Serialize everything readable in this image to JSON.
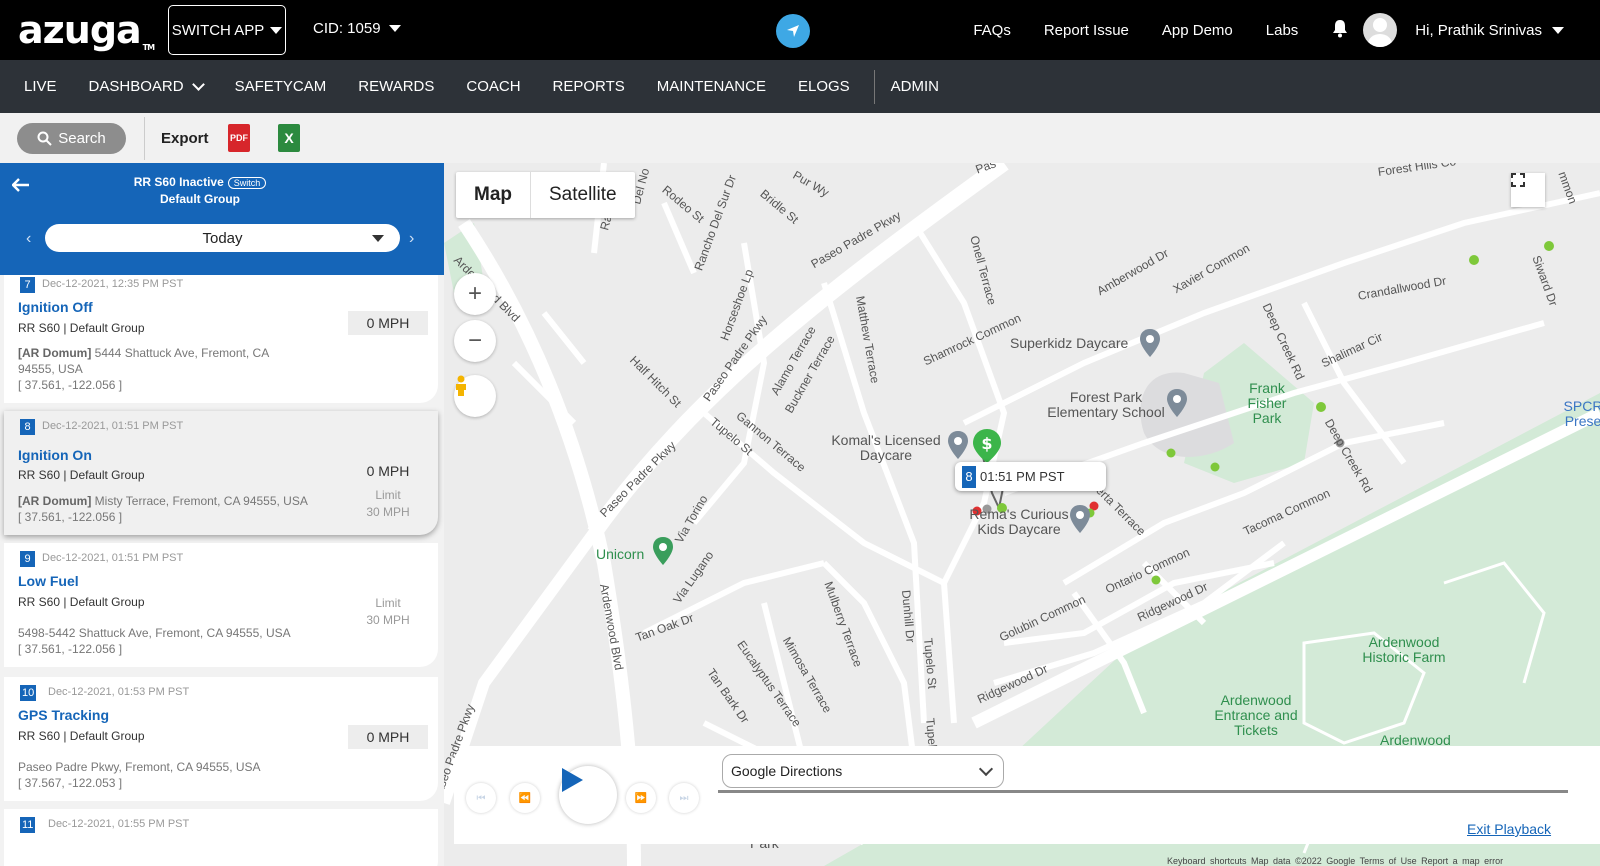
{
  "header": {
    "logo_text": "azuga",
    "logo_tm": "TM",
    "switch_app_label": "SWITCH APP",
    "cid_label": "CID: 1059",
    "links": [
      "FAQs",
      "Report Issue",
      "App Demo",
      "Labs"
    ],
    "greeting": "Hi, Prathik Srinivas",
    "nav_accent": "#3ea8e5"
  },
  "nav": {
    "items": [
      "LIVE",
      "DASHBOARD",
      "SAFETYCAM",
      "REWARDS",
      "COACH",
      "REPORTS",
      "MAINTENANCE",
      "ELOGS"
    ],
    "admin": "ADMIN"
  },
  "toolbar": {
    "search_label": "Search",
    "export_label": "Export",
    "pdf_label": "PDF",
    "xls_label": "X"
  },
  "vehicle": {
    "title": "RR S60 Inactive",
    "switch_label": "Switch",
    "group": "Default Group",
    "date_value": "Today"
  },
  "events": [
    {
      "num": "7",
      "time": "Dec-12-2021, 12:35 PM PST",
      "title": "Ignition Off",
      "sub": "RR S60 | Default Group",
      "addr_bold": "[AR Domum]",
      "addr": " 5444 Shattuck Ave, Fremont, CA 94555, USA",
      "coords": "[ 37.561, -122.056 ]",
      "speed": "0 MPH",
      "limit_label": "",
      "limit_value": ""
    },
    {
      "num": "8",
      "time": "Dec-12-2021, 01:51 PM PST",
      "title": "Ignition On",
      "sub": "RR S60 | Default Group",
      "addr_bold": "[AR Domum]",
      "addr": " Misty Terrace, Fremont, CA 94555, USA",
      "coords": "[ 37.561, -122.056 ]",
      "speed": "0 MPH",
      "limit_label": "Limit",
      "limit_value": "30 MPH"
    },
    {
      "num": "9",
      "time": "Dec-12-2021, 01:51 PM PST",
      "title": "Low Fuel",
      "sub": "RR S60 | Default Group",
      "addr_bold": "",
      "addr": "5498-5442 Shattuck Ave, Fremont, CA 94555, USA",
      "coords": "[ 37.561, -122.056 ]",
      "speed": "",
      "limit_label": "Limit",
      "limit_value": "30 MPH"
    },
    {
      "num": "10",
      "time": "Dec-12-2021, 01:53 PM PST",
      "title": "GPS Tracking",
      "sub": "RR S60 | Default Group",
      "addr_bold": "",
      "addr": "Paseo Padre Pkwy, Fremont, CA 94555, USA",
      "coords": "[ 37.567, -122.053 ]",
      "speed": "0 MPH",
      "limit_label": "",
      "limit_value": ""
    },
    {
      "num": "11",
      "time": "Dec-12-2021, 01:55 PM PST",
      "title": "",
      "sub": "",
      "addr_bold": "",
      "addr": "",
      "coords": "",
      "speed": "",
      "limit_label": "",
      "limit_value": ""
    }
  ],
  "map": {
    "type_map": "Map",
    "type_satellite": "Satellite",
    "zoom_in": "+",
    "zoom_out": "−",
    "tooltip_num": "8",
    "tooltip_time": "01:51 PM PST",
    "marker_letter": "$",
    "pois": {
      "superkidz": "Superkidz Daycare",
      "forest_park": "Forest Park Elementary School",
      "frank_fisher": "Frank Fisher Park",
      "komals": "Komal's Licensed Daycare",
      "remas": "Rema's Curious Kids Daycare",
      "unicorn": "Unicorn",
      "ardenwood_farm": "Ardenwood Historic Farm",
      "ardenwood_entrance": "Ardenwood Entrance and Tickets",
      "ardenwood_bottom": "Ardenwood",
      "spcr": "SPCR Prese",
      "park_bottom": "Park"
    },
    "streets": {
      "paseo1": "Paseo Padre Pkwy",
      "paseo2": "Paseo Padre Pkwy",
      "paseo3": "Paseo Padre Pkwy",
      "paseo4": "Paseo Padre Pkwy",
      "ardenwood1": "Ardenwood Blvd",
      "ardenwood2": "Ardenwood Blvd",
      "rodeo": "Rodeo St",
      "rancho": "Rancho Del Sur Dr",
      "bridle": "Bridle St",
      "pur": "Pur Wy",
      "horseshoe": "Horseshoe Lp",
      "half_hitch": "Half Hitch St",
      "alamo": "Alamo Terrace",
      "buckner": "Buckner Terrace",
      "matthew": "Matthew Terrace",
      "onell": "Onell Terrace",
      "shamrock": "Shamrock Common",
      "amberwood": "Amberwood Dr",
      "xavier": "Xavier Common",
      "crandallwood": "Crandallwood Dr",
      "deep_creek1": "Deep Creek Rd",
      "deep_creek2": "Deep Creek Rd",
      "shalimar": "Shalimar Cir",
      "gannon": "Gannon Terrace",
      "tupelo1": "Tupelo St",
      "tupelo2": "Tupelo St",
      "alberta": "Alberta Terrace",
      "tacoma": "Tacoma Common",
      "ontario": "Ontario Common",
      "golubin": "Golubin Common",
      "ridgewood1": "Ridgewood Dr",
      "ridgewood2": "Ridgewood Dr",
      "dunhill": "Dunhill Dr",
      "via_torino": "Via Torino",
      "via_lugano": "Via Lugano",
      "tan_oak": "Tan Oak Dr",
      "tan_bark": "Tan Bark Dr",
      "eucalyptus": "Eucalyptus Terrace",
      "mimosa": "Mimosa Terrace",
      "mulberry": "Mulberry Terrace",
      "forest_hills": "Forest Hills Co",
      "siward": "Siward Dr",
      "rancho_top": "Ran",
      "del_no": "Del No",
      "pas": "Pas",
      "ammon": "mmon",
      "tupelo3": "Tupelo"
    },
    "attribution": "Keyboard shortcuts   Map data ©2022 Google   Terms of Use   Report a map error"
  },
  "playback": {
    "directions_value": "Google Directions",
    "exit_label": "Exit Playback"
  }
}
